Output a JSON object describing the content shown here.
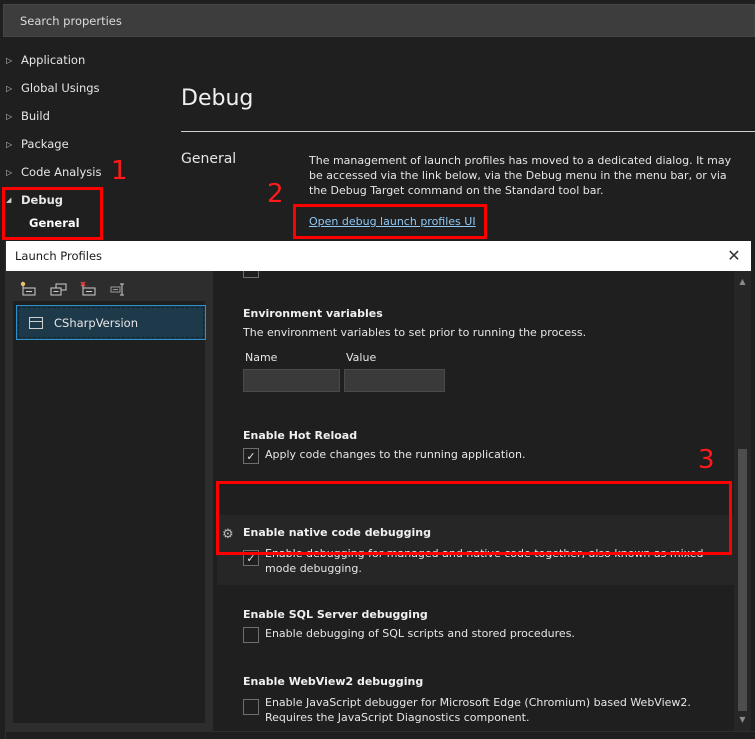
{
  "search": {
    "placeholder": "Search properties"
  },
  "nav": {
    "items": [
      {
        "label": "Application",
        "expanded": false
      },
      {
        "label": "Global Usings",
        "expanded": false
      },
      {
        "label": "Build",
        "expanded": false
      },
      {
        "label": "Package",
        "expanded": false
      },
      {
        "label": "Code Analysis",
        "expanded": false
      },
      {
        "label": "Debug",
        "expanded": true,
        "selected": true
      }
    ],
    "sub_item": "General",
    "arrow_collapsed": "▷",
    "arrow_expanded": "◢"
  },
  "page": {
    "title": "Debug",
    "section": "General",
    "description": "The management of launch profiles has moved to a dedicated dialog. It may be accessed via the link below, via the Debug menu in the menu bar, or via the Debug Target command on the Standard tool bar.",
    "link": "Open debug launch profiles UI"
  },
  "annotations": {
    "one": "1",
    "two": "2",
    "three": "3",
    "color": "#ff0000"
  },
  "dialog": {
    "title": "Launch Profiles",
    "close_glyph": "✕",
    "toolbar": [
      {
        "name": "new-profile-icon"
      },
      {
        "name": "copy-profile-icon"
      },
      {
        "name": "delete-profile-icon"
      },
      {
        "name": "rename-profile-icon"
      }
    ],
    "profiles": [
      {
        "label": "CSharpVersion",
        "selected": true
      }
    ],
    "env": {
      "title": "Environment variables",
      "desc": "The environment variables to set prior to running the process.",
      "col_name": "Name",
      "col_value": "Value",
      "name_value": "",
      "value_value": ""
    },
    "hot_reload": {
      "title": "Enable Hot Reload",
      "label": "Apply code changes to the running application.",
      "checked": true
    },
    "native": {
      "title": "Enable native code debugging",
      "label": "Enable debugging for managed and native code together, also known as mixed-mode debugging.",
      "checked": true
    },
    "sql": {
      "title": "Enable SQL Server debugging",
      "label": "Enable debugging of SQL scripts and stored procedures.",
      "checked": false
    },
    "webview": {
      "title": "Enable WebView2 debugging",
      "label": "Enable JavaScript debugger for Microsoft Edge (Chromium) based WebView2. Requires the JavaScript Diagnostics component.",
      "checked": false
    },
    "check_glyph": "✓",
    "gear_glyph": "⚙",
    "scroll_up": "▲",
    "scroll_down": "▼"
  }
}
